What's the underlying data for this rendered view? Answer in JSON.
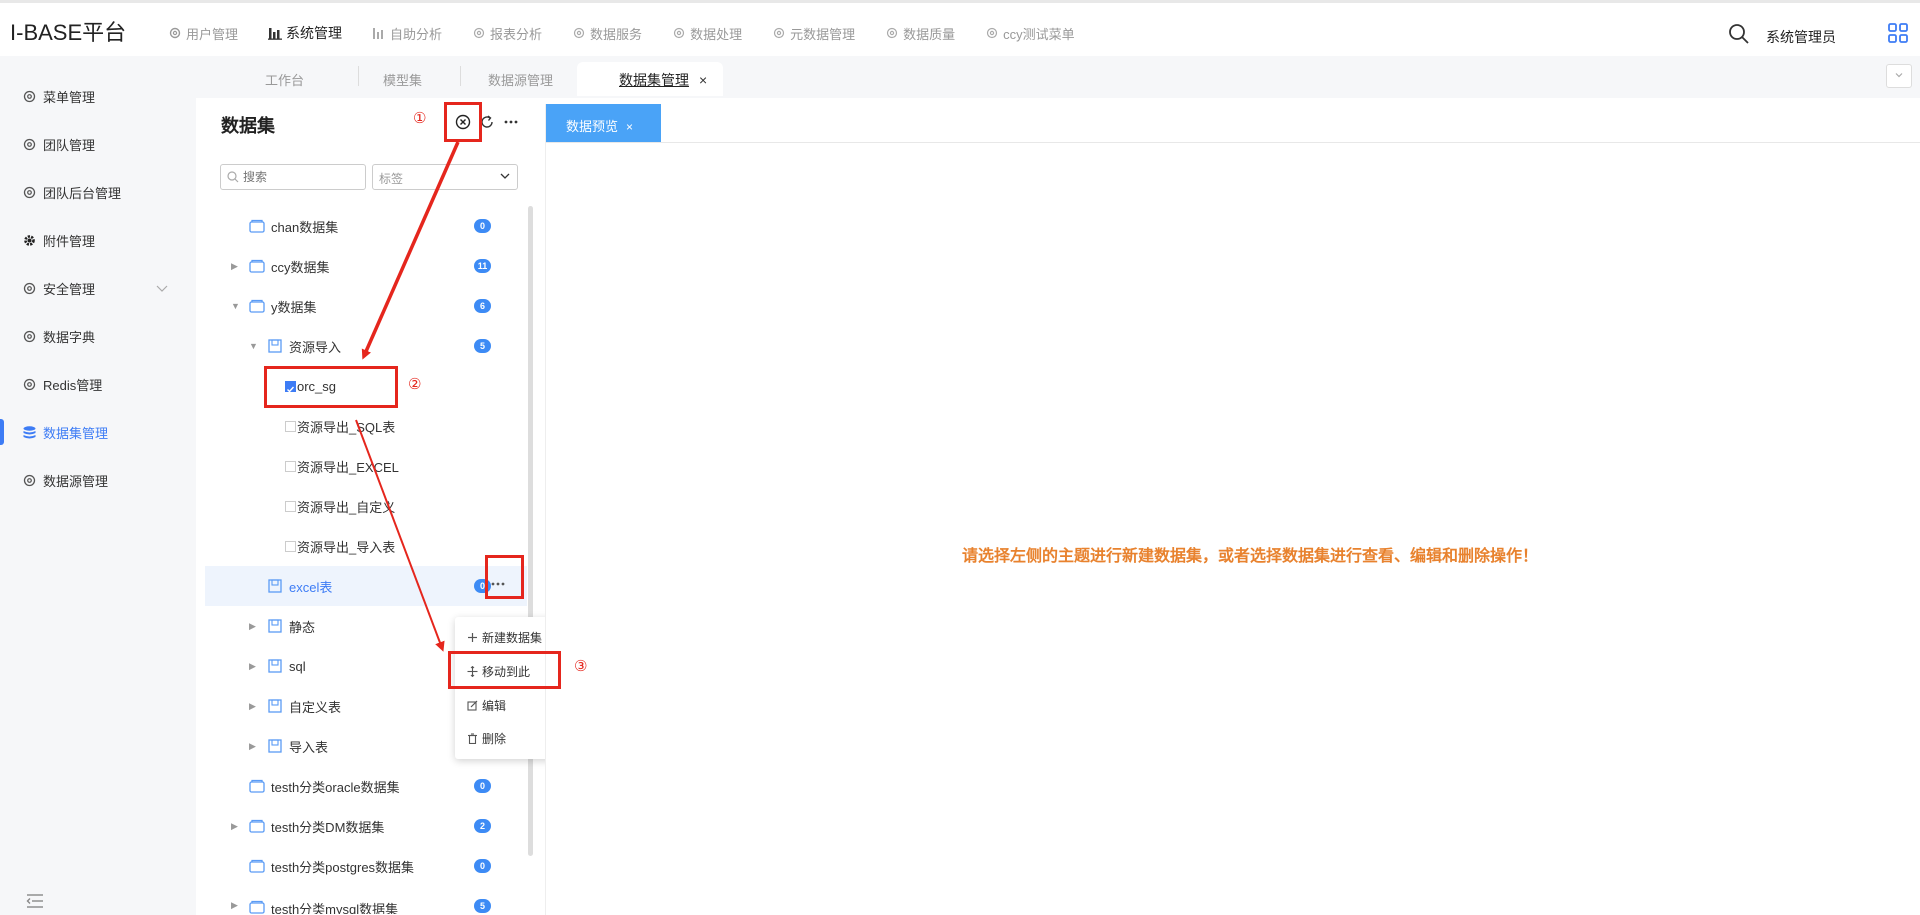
{
  "app": {
    "title": "I-BASE平台",
    "user": "系统管理员"
  },
  "topnav": [
    {
      "label": "用户管理"
    },
    {
      "label": "系统管理"
    },
    {
      "label": "自助分析"
    },
    {
      "label": "报表分析"
    },
    {
      "label": "数据服务"
    },
    {
      "label": "数据处理"
    },
    {
      "label": "元数据管理"
    },
    {
      "label": "数据质量"
    },
    {
      "label": "ccy测试菜单"
    }
  ],
  "tabs": [
    {
      "label": "工作台"
    },
    {
      "label": "模型集"
    },
    {
      "label": "数据源管理"
    },
    {
      "label": "数据集管理",
      "close": "×"
    }
  ],
  "sidebar": {
    "items": [
      {
        "label": "菜单管理"
      },
      {
        "label": "团队管理"
      },
      {
        "label": "团队后台管理"
      },
      {
        "label": "附件管理"
      },
      {
        "label": "安全管理"
      },
      {
        "label": "数据字典"
      },
      {
        "label": "Redis管理"
      },
      {
        "label": "数据集管理"
      },
      {
        "label": "数据源管理"
      }
    ]
  },
  "panel": {
    "title": "数据集",
    "search_placeholder": "搜索",
    "tag_placeholder": "标签"
  },
  "tree": [
    {
      "label": "chan数据集",
      "badge": "0"
    },
    {
      "label": "ccy数据集",
      "badge": "11"
    },
    {
      "label": "y数据集",
      "badge": "6"
    },
    {
      "label": "资源导入",
      "badge": "5"
    },
    {
      "label": "orc_sg"
    },
    {
      "label": "资源导出_SQL表"
    },
    {
      "label": "资源导出_EXCEL"
    },
    {
      "label": "资源导出_自定义"
    },
    {
      "label": "资源导出_导入表"
    },
    {
      "label": "excel表",
      "badge": "0"
    },
    {
      "label": "静态"
    },
    {
      "label": "sql"
    },
    {
      "label": "自定义表"
    },
    {
      "label": "导入表"
    },
    {
      "label": "testh分类oracle数据集",
      "badge": "0"
    },
    {
      "label": "testh分类DM数据集",
      "badge": "2"
    },
    {
      "label": "testh分类postgres数据集",
      "badge": "0"
    },
    {
      "label": "testh分类mysql数据集",
      "badge": "5"
    }
  ],
  "context_menu": [
    {
      "label": "新建数据集"
    },
    {
      "label": "移动到此"
    },
    {
      "label": "编辑"
    },
    {
      "label": "删除"
    }
  ],
  "preview": {
    "tab_label": "数据预览",
    "tab_close": "×",
    "hint": "请选择左侧的主题进行新建数据集，或者选择数据集进行查看、编辑和删除操作！"
  },
  "annotations": [
    "①",
    "②",
    "③"
  ],
  "colors": {
    "accent": "#3d7cf5",
    "annotation": "#e5261d",
    "hint": "#e8822e",
    "preview_tab": "#4aa3f7"
  }
}
